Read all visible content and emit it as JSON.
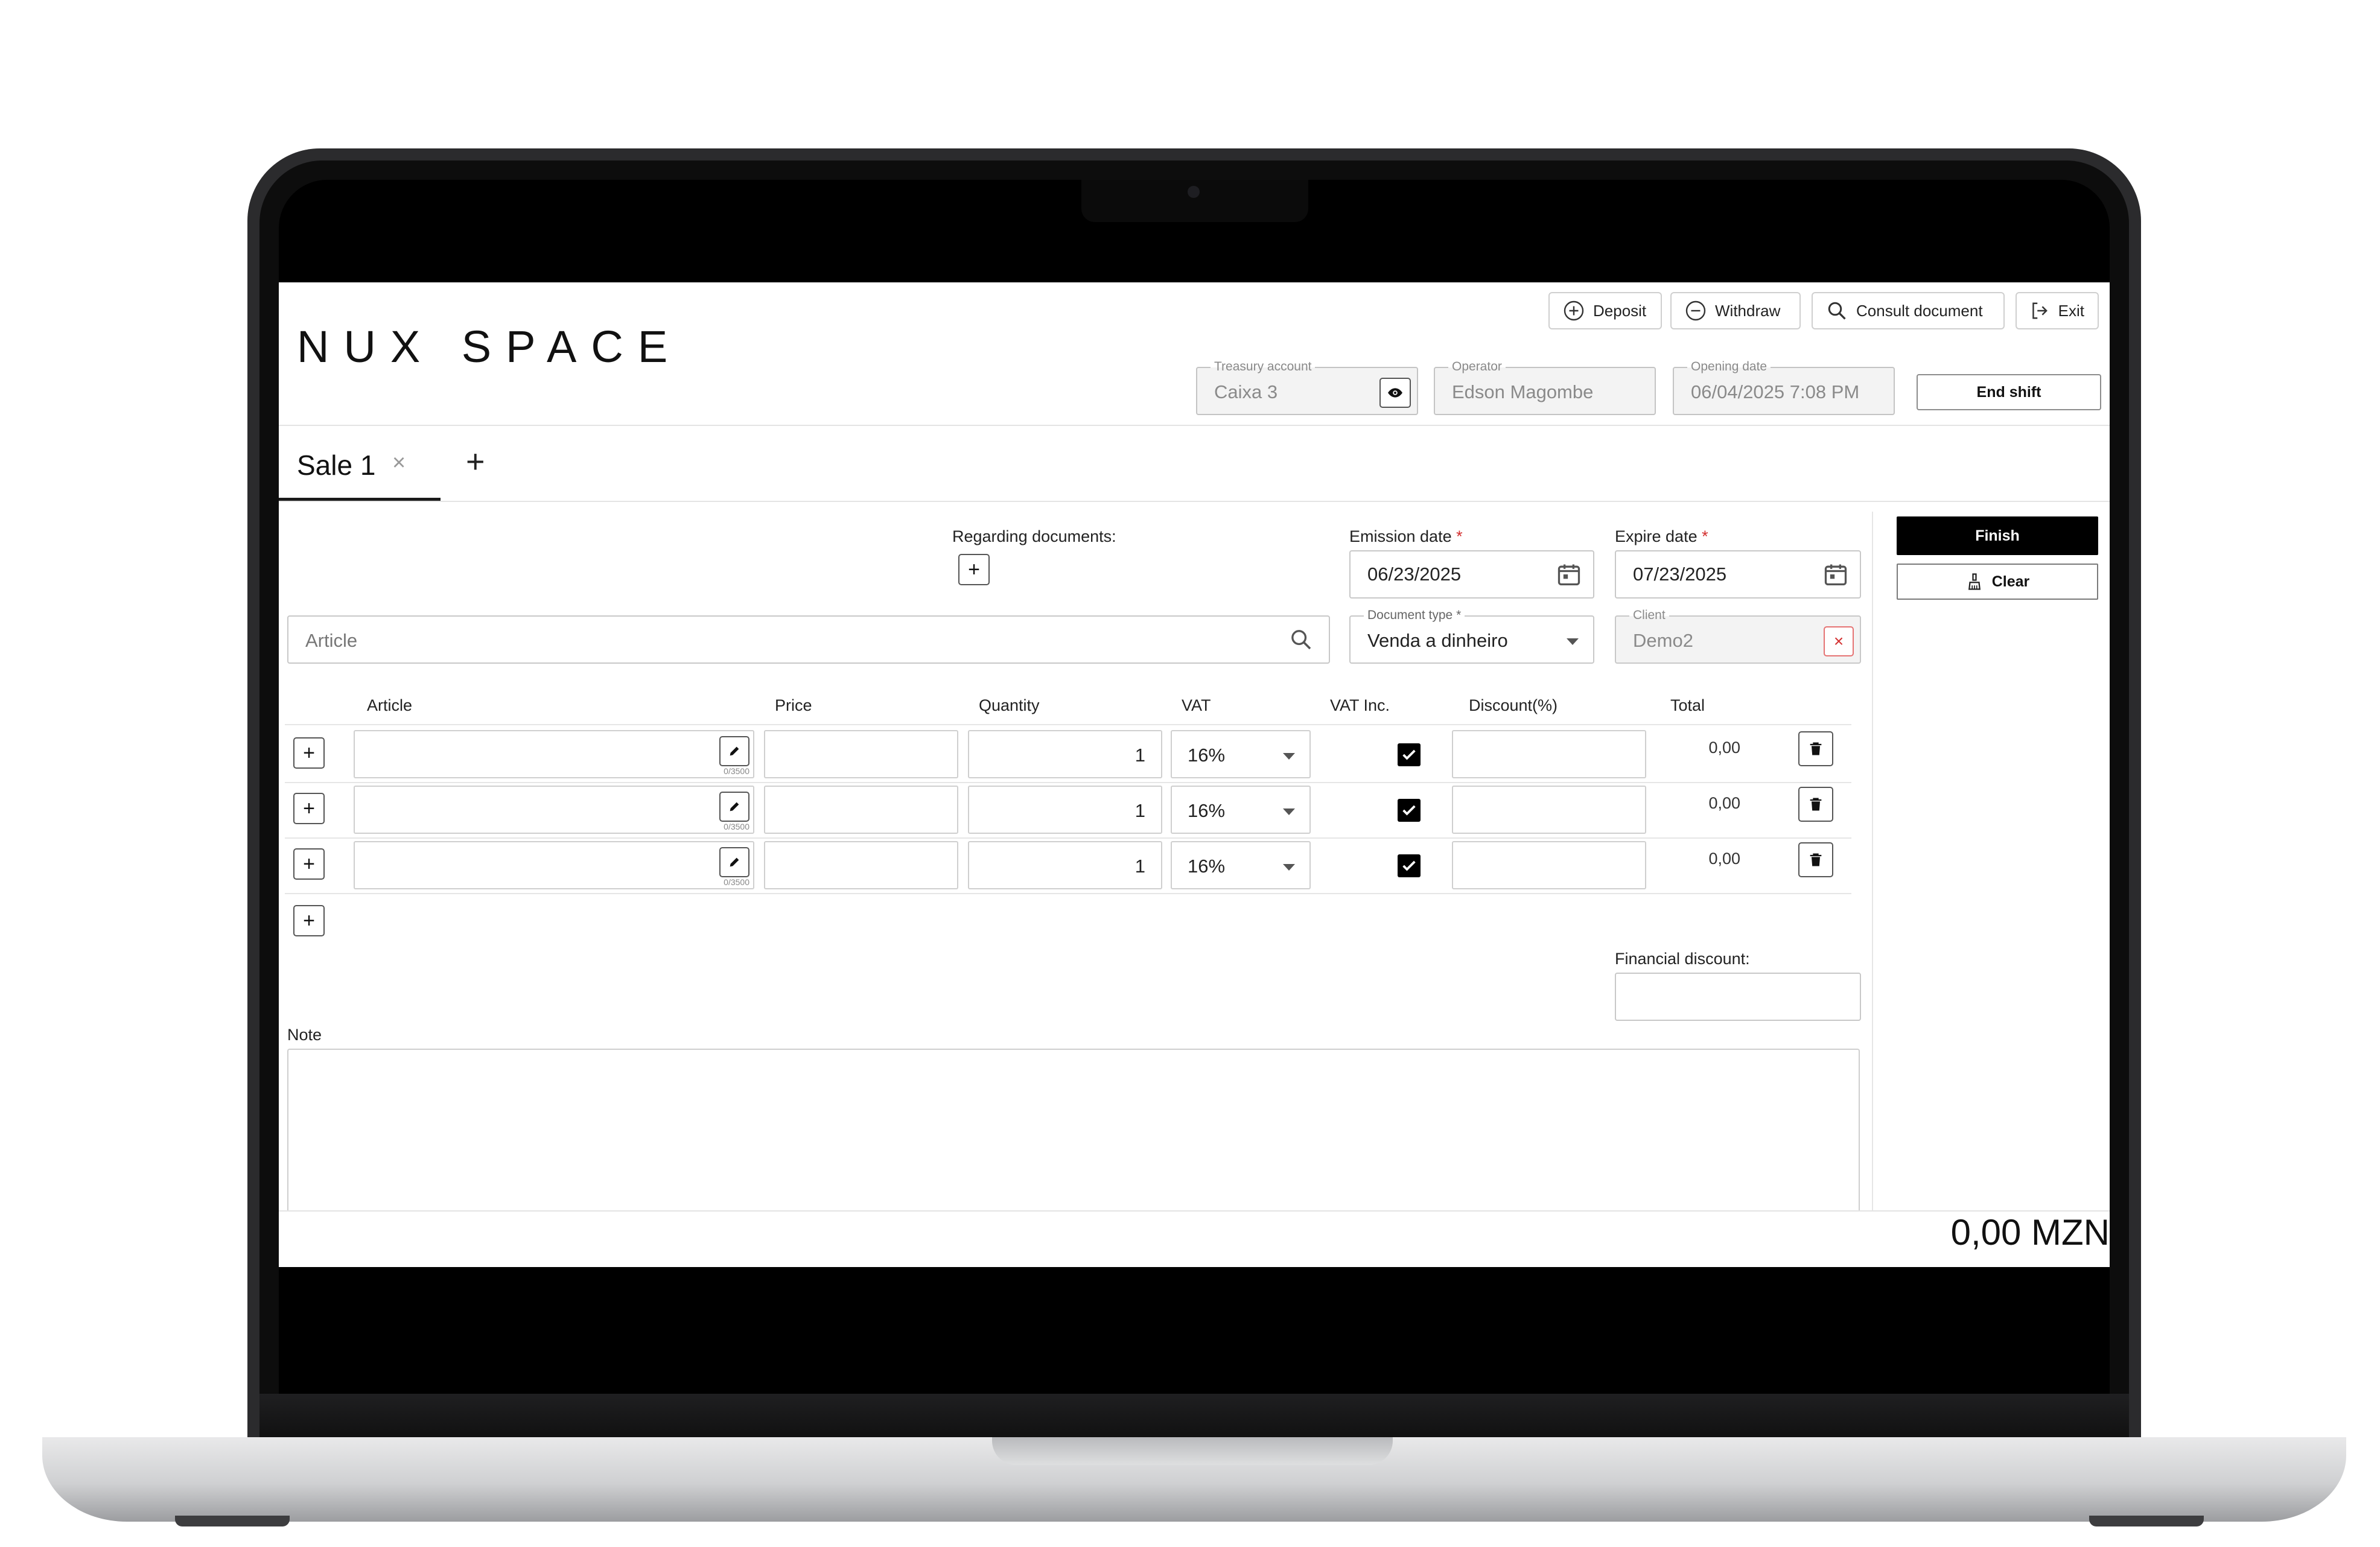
{
  "app": {
    "logo_text": "NUX SPACE"
  },
  "toolbar": {
    "deposit_label": "Deposit",
    "withdraw_label": "Withdraw",
    "consult_label": "Consult document",
    "exit_label": "Exit",
    "end_shift_label": "End shift"
  },
  "shift": {
    "treasury_label": "Treasury account",
    "treasury_value": "Caixa 3",
    "operator_label": "Operator",
    "operator_value": "Edson Magombe",
    "opening_label": "Opening date",
    "opening_value": "06/04/2025 7:08 PM"
  },
  "tabs": [
    {
      "label": "Sale 1",
      "close": "×"
    }
  ],
  "tab_add": "+",
  "form": {
    "regarding_label": "Regarding documents:",
    "emission_label": "Emission date",
    "emission_value": "06/23/2025",
    "expire_label": "Expire date",
    "expire_value": "07/23/2025",
    "required_mark": "*",
    "article_placeholder": "Article",
    "doc_type_label": "Document type *",
    "doc_type_value": "Venda a dinheiro",
    "client_label": "Client",
    "client_value": "Demo2",
    "client_clear": "×",
    "financial_discount_label": "Financial discount:",
    "note_label": "Note"
  },
  "actions": {
    "finish_label": "Finish",
    "clear_label": "Clear"
  },
  "table": {
    "headers": [
      "Article",
      "Price",
      "Quantity",
      "VAT",
      "VAT Inc.",
      "Discount(%)",
      "Total"
    ],
    "rows": [
      {
        "article": "",
        "counter": "0/3500",
        "price": "",
        "quantity": "1",
        "vat": "16%",
        "vat_inc": true,
        "discount": "",
        "total": "0,00"
      },
      {
        "article": "",
        "counter": "0/3500",
        "price": "",
        "quantity": "1",
        "vat": "16%",
        "vat_inc": true,
        "discount": "",
        "total": "0,00"
      },
      {
        "article": "",
        "counter": "0/3500",
        "price": "",
        "quantity": "1",
        "vat": "16%",
        "vat_inc": true,
        "discount": "",
        "total": "0,00"
      }
    ],
    "add_row": "+"
  },
  "summary": {
    "grand_total": "0,00 MZN"
  }
}
